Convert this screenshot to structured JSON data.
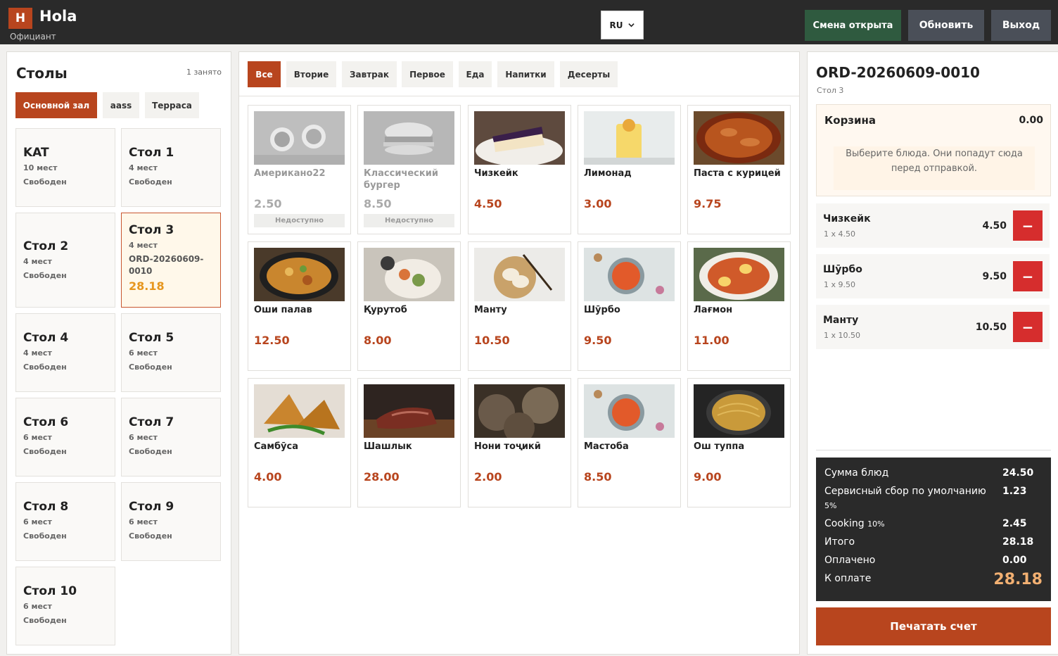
{
  "header": {
    "logo_letter": "H",
    "app_name": "Hola",
    "role": "Официант",
    "language": "RU",
    "shift_button": "Смена открыта",
    "refresh_button": "Обновить",
    "exit_button": "Выход"
  },
  "tables_panel": {
    "title": "Столы",
    "occupied": "1 занято",
    "halls": [
      "Основной зал",
      "aass",
      "Терраса"
    ],
    "active_hall": "Основной зал",
    "tables": [
      {
        "name": "KAT",
        "seats": "10 мест",
        "status": "Свободен"
      },
      {
        "name": "Стол 1",
        "seats": "4 мест",
        "status": "Свободен"
      },
      {
        "name": "Стол 2",
        "seats": "4 мест",
        "status": "Свободен"
      },
      {
        "name": "Стол 3",
        "seats": "4 мест",
        "order": "ORD-20260609-0010",
        "total": "28.18",
        "selected": true
      },
      {
        "name": "Стол 4",
        "seats": "4 мест",
        "status": "Свободен"
      },
      {
        "name": "Стол 5",
        "seats": "6 мест",
        "status": "Свободен"
      },
      {
        "name": "Стол 6",
        "seats": "6 мест",
        "status": "Свободен"
      },
      {
        "name": "Стол 7",
        "seats": "6 мест",
        "status": "Свободен"
      },
      {
        "name": "Стол 8",
        "seats": "6 мест",
        "status": "Свободен"
      },
      {
        "name": "Стол 9",
        "seats": "6 мест",
        "status": "Свободен"
      },
      {
        "name": "Стол 10",
        "seats": "6 мест",
        "status": "Свободен"
      }
    ]
  },
  "menu": {
    "categories": [
      "Все",
      "Вторие",
      "Завтрак",
      "Первое",
      "Еда",
      "Напитки",
      "Десерты"
    ],
    "active_category": "Все",
    "unavailable_label": "Недоступно",
    "products": [
      {
        "name": "Американо22",
        "price": "2.50",
        "available": false,
        "icon": "coffee-image"
      },
      {
        "name": "Классический бургер",
        "price": "8.50",
        "available": false,
        "icon": "burger-image"
      },
      {
        "name": "Чизкейк",
        "price": "4.50",
        "available": true,
        "icon": "cheesecake-image"
      },
      {
        "name": "Лимонад",
        "price": "3.00",
        "available": true,
        "icon": "lemonade-image"
      },
      {
        "name": "Паста с курицей",
        "price": "9.75",
        "available": true,
        "icon": "pasta-image"
      },
      {
        "name": "Оши палав",
        "price": "12.50",
        "available": true,
        "icon": "plov-image"
      },
      {
        "name": "Қурутоб",
        "price": "8.00",
        "available": true,
        "icon": "qurutob-image"
      },
      {
        "name": "Манту",
        "price": "10.50",
        "available": true,
        "icon": "mantu-image"
      },
      {
        "name": "Шӯрбо",
        "price": "9.50",
        "available": true,
        "icon": "soup-image"
      },
      {
        "name": "Лағмон",
        "price": "11.00",
        "available": true,
        "icon": "lagman-image"
      },
      {
        "name": "Самбӯса",
        "price": "4.00",
        "available": true,
        "icon": "samsa-image"
      },
      {
        "name": "Шашлык",
        "price": "28.00",
        "available": true,
        "icon": "shashlik-image"
      },
      {
        "name": "Нони тоҷикӣ",
        "price": "2.00",
        "available": true,
        "icon": "bread-image"
      },
      {
        "name": "Мастоба",
        "price": "8.50",
        "available": true,
        "icon": "soup-image"
      },
      {
        "name": "Ош туппа",
        "price": "9.00",
        "available": true,
        "icon": "noodles-image"
      }
    ]
  },
  "order": {
    "id": "ORD-20260609-0010",
    "table": "Стол 3",
    "cart_title": "Корзина",
    "cart_total": "0.00",
    "cart_hint": "Выберите блюда. Они попадут сюда перед отправкой.",
    "items": [
      {
        "name": "Чизкейк",
        "qty": "1 x 4.50",
        "price": "4.50"
      },
      {
        "name": "Шӯрбо",
        "qty": "1 x 9.50",
        "price": "9.50"
      },
      {
        "name": "Манту",
        "qty": "1 x 10.50",
        "price": "10.50"
      }
    ],
    "remove_symbol": "−",
    "summary": {
      "dishes_label": "Сумма блюд",
      "dishes_value": "24.50",
      "service_label": "Сервисный сбор по умолчанию",
      "service_pct": "5%",
      "service_value": "1.23",
      "cooking_label": "Cooking",
      "cooking_pct": "10%",
      "cooking_value": "2.45",
      "total_label": "Итого",
      "total_value": "28.18",
      "paid_label": "Оплачено",
      "paid_value": "0.00",
      "due_label": "К оплате",
      "due_value": "28.18"
    },
    "print_button": "Печатать счет"
  },
  "colors": {
    "accent": "#b8451e",
    "topbar": "#2a2a2a",
    "shift_green": "#2f5a3f",
    "remove_red": "#d62d2d",
    "selected_total": "#e6961e",
    "due_amount": "#f2b072"
  }
}
